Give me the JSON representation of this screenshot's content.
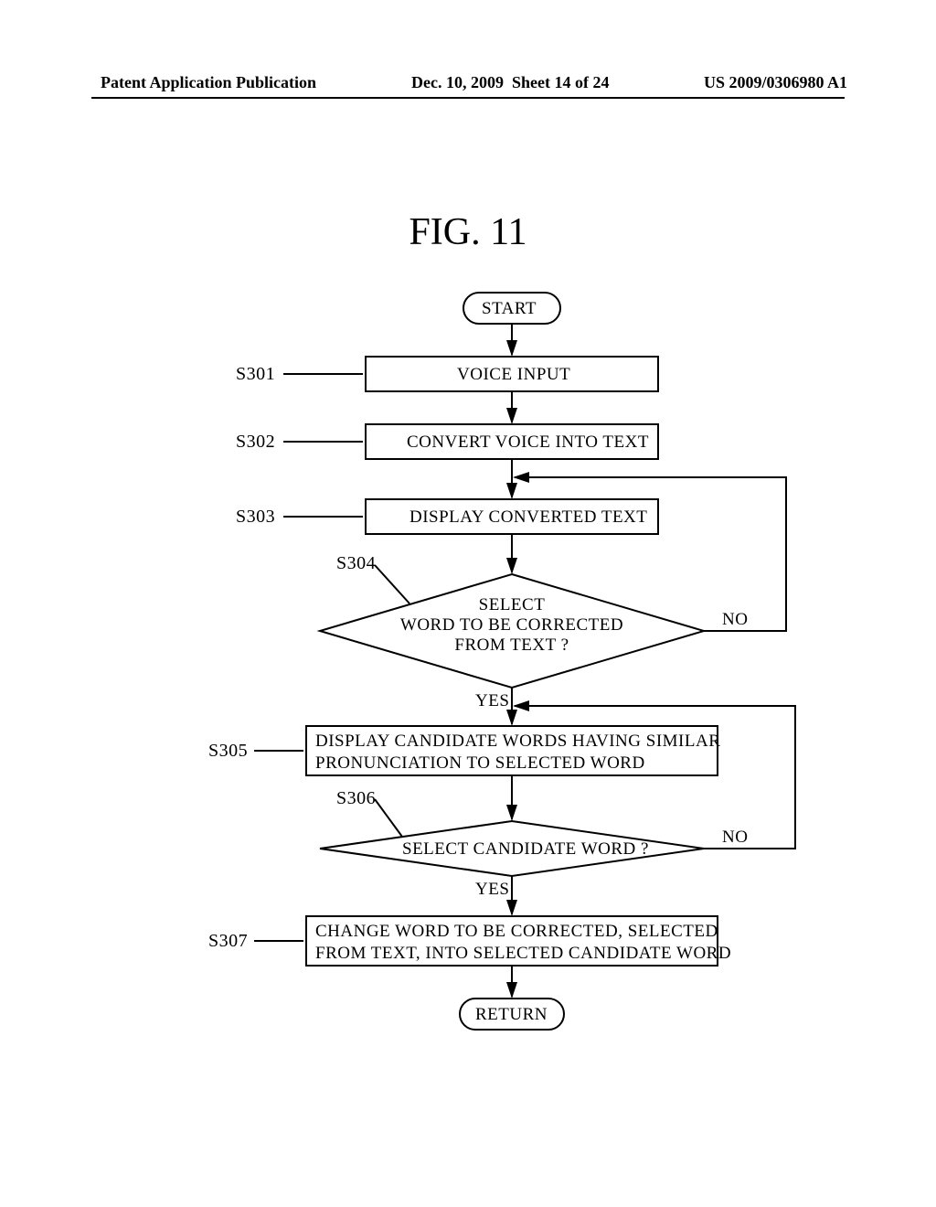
{
  "header": {
    "left": "Patent Application Publication",
    "date": "Dec. 10, 2009",
    "sheet": "Sheet 14 of 24",
    "pubno": "US 2009/0306980 A1"
  },
  "figure_title": "FIG.  11",
  "flow": {
    "start": "START",
    "s301": {
      "id": "S301",
      "text": "VOICE INPUT"
    },
    "s302": {
      "id": "S302",
      "text": "CONVERT VOICE INTO TEXT"
    },
    "s303": {
      "id": "S303",
      "text": "DISPLAY CONVERTED TEXT"
    },
    "s304": {
      "id": "S304",
      "text": "SELECT\nWORD TO BE CORRECTED\nFROM TEXT ?"
    },
    "s305": {
      "id": "S305",
      "text": "DISPLAY CANDIDATE WORDS HAVING SIMILAR\nPRONUNCIATION TO SELECTED WORD"
    },
    "s306": {
      "id": "S306",
      "text": "SELECT CANDIDATE WORD ?"
    },
    "s307": {
      "id": "S307",
      "text": "CHANGE WORD TO BE CORRECTED, SELECTED\nFROM TEXT, INTO SELECTED CANDIDATE WORD"
    },
    "end": "RETURN",
    "yes": "YES",
    "no": "NO"
  },
  "chart_data": {
    "type": "table",
    "title": "Flowchart FIG. 11 — voice-to-text correction",
    "nodes": [
      {
        "id": "START",
        "kind": "terminator",
        "label": "START"
      },
      {
        "id": "S301",
        "kind": "process",
        "label": "VOICE INPUT"
      },
      {
        "id": "S302",
        "kind": "process",
        "label": "CONVERT VOICE INTO TEXT"
      },
      {
        "id": "S303",
        "kind": "process",
        "label": "DISPLAY CONVERTED TEXT"
      },
      {
        "id": "S304",
        "kind": "decision",
        "label": "SELECT WORD TO BE CORRECTED FROM TEXT ?"
      },
      {
        "id": "S305",
        "kind": "process",
        "label": "DISPLAY CANDIDATE WORDS HAVING SIMILAR PRONUNCIATION TO SELECTED WORD"
      },
      {
        "id": "S306",
        "kind": "decision",
        "label": "SELECT CANDIDATE WORD ?"
      },
      {
        "id": "S307",
        "kind": "process",
        "label": "CHANGE WORD TO BE CORRECTED, SELECTED FROM TEXT, INTO SELECTED CANDIDATE WORD"
      },
      {
        "id": "RETURN",
        "kind": "terminator",
        "label": "RETURN"
      }
    ],
    "edges": [
      {
        "from": "START",
        "to": "S301"
      },
      {
        "from": "S301",
        "to": "S302"
      },
      {
        "from": "S302",
        "to": "S303"
      },
      {
        "from": "S303",
        "to": "S304"
      },
      {
        "from": "S304",
        "to": "S305",
        "label": "YES"
      },
      {
        "from": "S304",
        "to": "S303",
        "label": "NO"
      },
      {
        "from": "S305",
        "to": "S306"
      },
      {
        "from": "S306",
        "to": "S307",
        "label": "YES"
      },
      {
        "from": "S306",
        "to": "S305",
        "label": "NO"
      },
      {
        "from": "S307",
        "to": "RETURN"
      }
    ]
  }
}
